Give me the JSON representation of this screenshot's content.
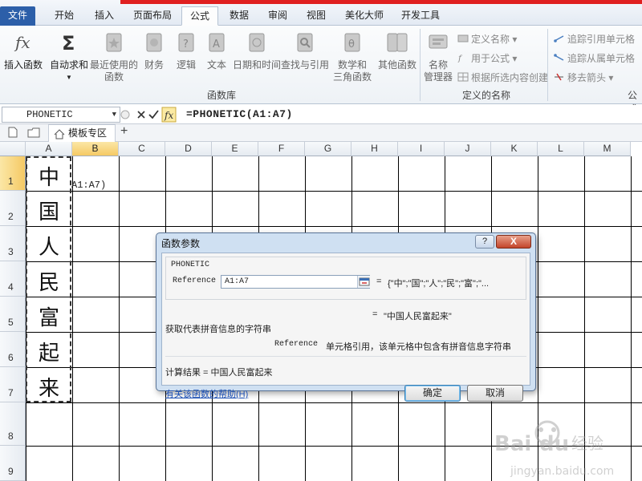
{
  "tabs": [
    "文件",
    "开始",
    "插入",
    "页面布局",
    "公式",
    "数据",
    "审阅",
    "视图",
    "美化大师",
    "开发工具"
  ],
  "active_tab": "公式",
  "ribbon": {
    "insert_function": "插入函数",
    "autosum": "自动求和",
    "recent": [
      "最近使用的",
      "函数"
    ],
    "financial": "财务",
    "logical": "逻辑",
    "text": "文本",
    "datetime": "日期和时间",
    "lookup": "查找与引用",
    "math": [
      "数学和",
      "三角函数"
    ],
    "more": "其他函数",
    "function_library_label": "函数库",
    "name_manager": [
      "名称",
      "管理器"
    ],
    "define_name": "定义名称",
    "use_in_formula": "用于公式",
    "create_from_selection": "根据所选内容创建",
    "defined_names_label": "定义的名称",
    "trace_precedents": "追踪引用单元格",
    "trace_dependents": "追踪从属单元格",
    "remove_arrows": "移去箭头",
    "formula_auditing_label": "公式"
  },
  "formula_bar": {
    "name_box": "PHONETIC",
    "formula": "=PHONETIC(A1:A7)"
  },
  "doc_tab": "模板专区",
  "columns": [
    "A",
    "B",
    "C",
    "D",
    "E",
    "F",
    "G",
    "H",
    "I",
    "J",
    "K",
    "L",
    "M"
  ],
  "rows": [
    "1",
    "2",
    "3",
    "4",
    "5",
    "6",
    "7",
    "8",
    "9"
  ],
  "cells_A": [
    "中",
    "国",
    "人",
    "民",
    "富",
    "起",
    "来"
  ],
  "cell_B1": "A1:A7)",
  "dialog": {
    "title": "函数参数",
    "help_btn": "?",
    "close_btn": "X",
    "function_name": "PHONETIC",
    "arg_name": "Reference",
    "arg_value": "A1:A7",
    "arg_eq": "=",
    "arg_preview": "{\"中\";\"国\";\"人\";\"民\";\"富\";\"...",
    "result_eq": "=",
    "result_preview": "\"中国人民富起来\"",
    "description": "获取代表拼音信息的字符串",
    "arg_desc_name": "Reference",
    "arg_desc": "单元格引用，该单元格中包含有拼音信息字符串",
    "calc_result": "计算结果 =  中国人民富起来",
    "help_link": "有关该函数的帮助(H)",
    "ok": "确定",
    "cancel": "取消"
  },
  "colors": {
    "file_tab": "#2c5fa9",
    "selection_header": "#f5c964",
    "dialog_frame": "#cfe0f2",
    "close_button": "#c3452a"
  }
}
